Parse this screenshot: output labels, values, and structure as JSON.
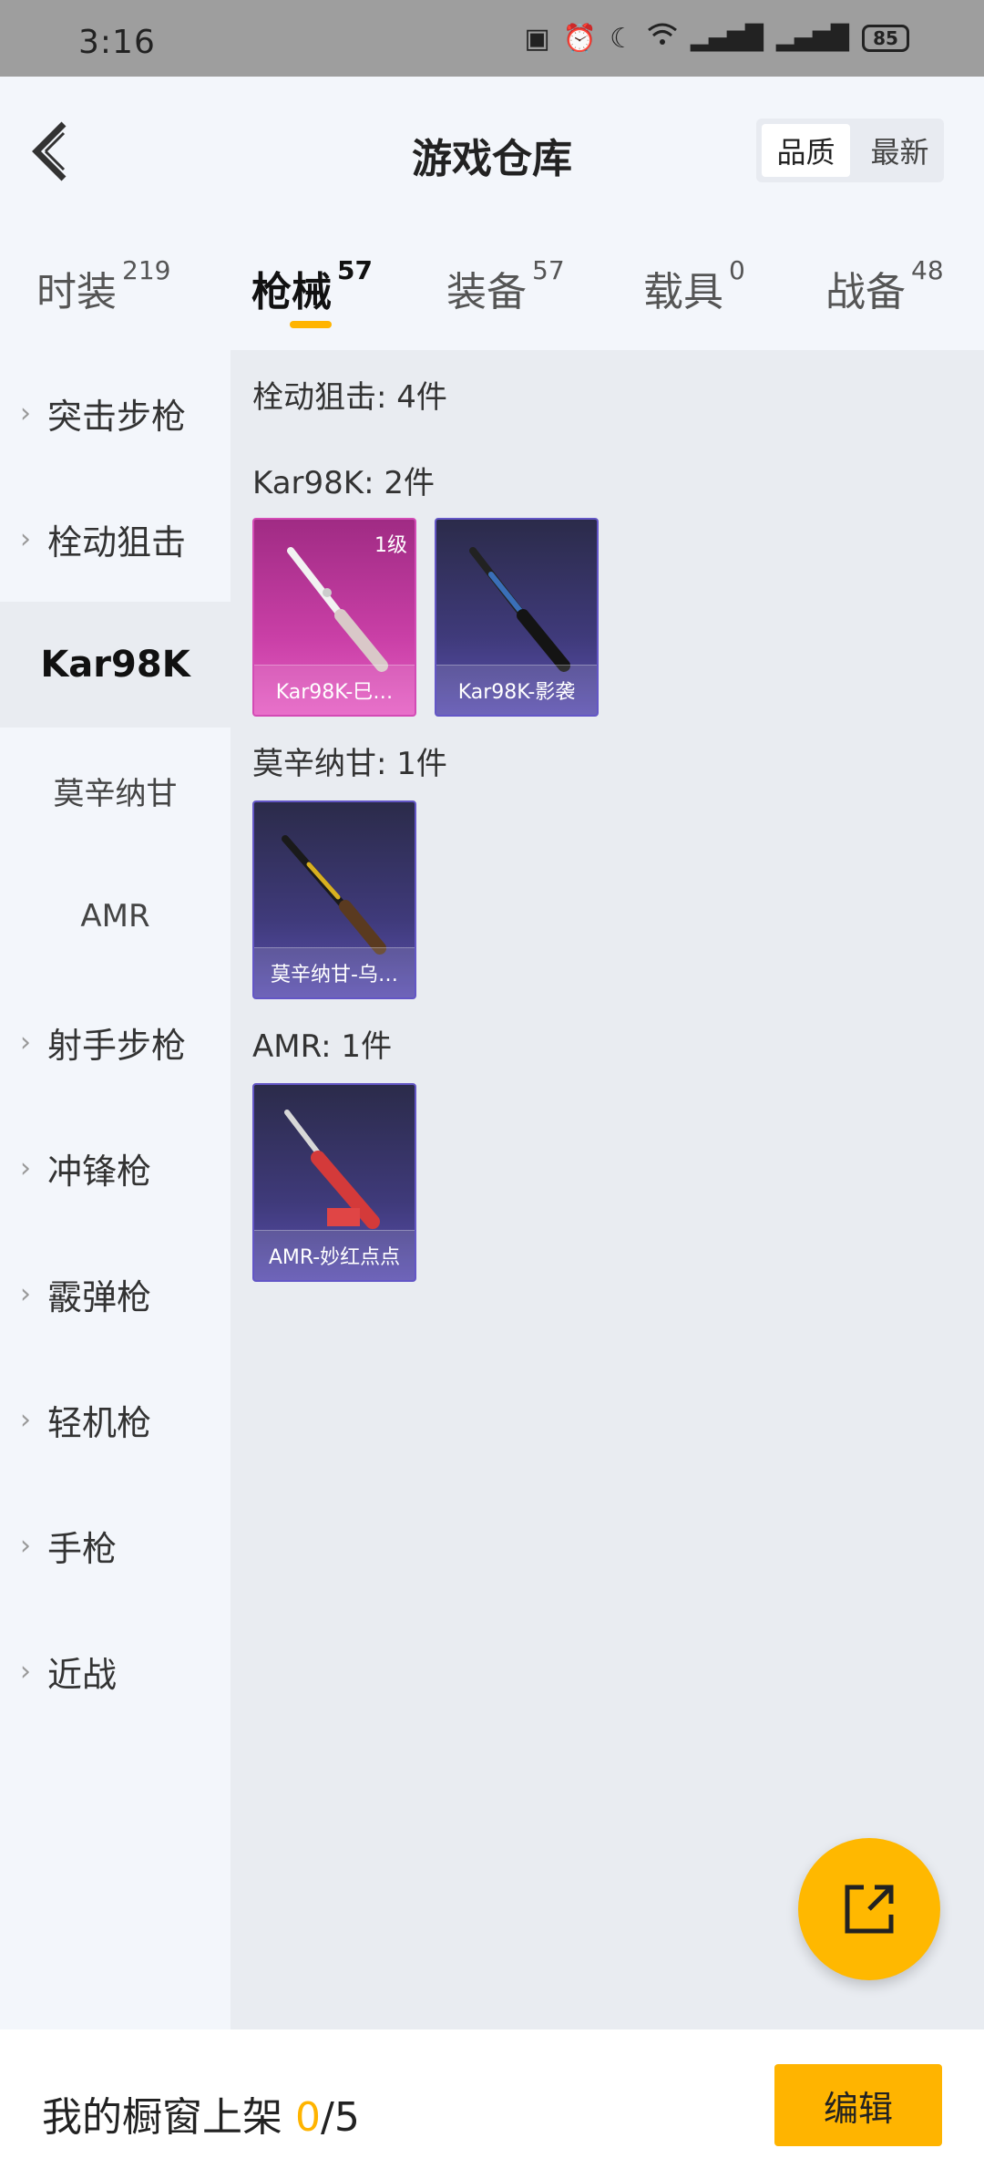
{
  "status_bar": {
    "time": "3:16",
    "battery": "85"
  },
  "header": {
    "title": "游戏仓库",
    "sort_options": [
      "品质",
      "最新"
    ]
  },
  "tabs": [
    {
      "label": "时装",
      "count": "219"
    },
    {
      "label": "枪械",
      "count": "57"
    },
    {
      "label": "装备",
      "count": "57"
    },
    {
      "label": "载具",
      "count": "0"
    },
    {
      "label": "战备",
      "count": "48"
    }
  ],
  "sidebar": {
    "items": [
      {
        "label": "突击步枪"
      },
      {
        "label": "栓动狙击"
      },
      {
        "label": "射手步枪"
      },
      {
        "label": "冲锋枪"
      },
      {
        "label": "霰弹枪"
      },
      {
        "label": "轻机枪"
      },
      {
        "label": "手枪"
      },
      {
        "label": "近战"
      }
    ],
    "sub_items": [
      {
        "label": "Kar98K"
      },
      {
        "label": "莫辛纳甘"
      },
      {
        "label": "AMR"
      }
    ]
  },
  "main": {
    "category_title": "栓动狙击: 4件",
    "groups": [
      {
        "title": "Kar98K: 2件",
        "cards": [
          {
            "name": "Kar98K-巳…",
            "level": "1级"
          },
          {
            "name": "Kar98K-影袭"
          }
        ]
      },
      {
        "title": "莫辛纳甘: 1件",
        "cards": [
          {
            "name": "莫辛纳甘-乌…"
          }
        ]
      },
      {
        "title": "AMR: 1件",
        "cards": [
          {
            "name": "AMR-妙红点点"
          }
        ]
      }
    ]
  },
  "bottom_bar": {
    "label": "我的橱窗上架",
    "current": "0",
    "total": "/5",
    "edit_label": "编辑"
  }
}
